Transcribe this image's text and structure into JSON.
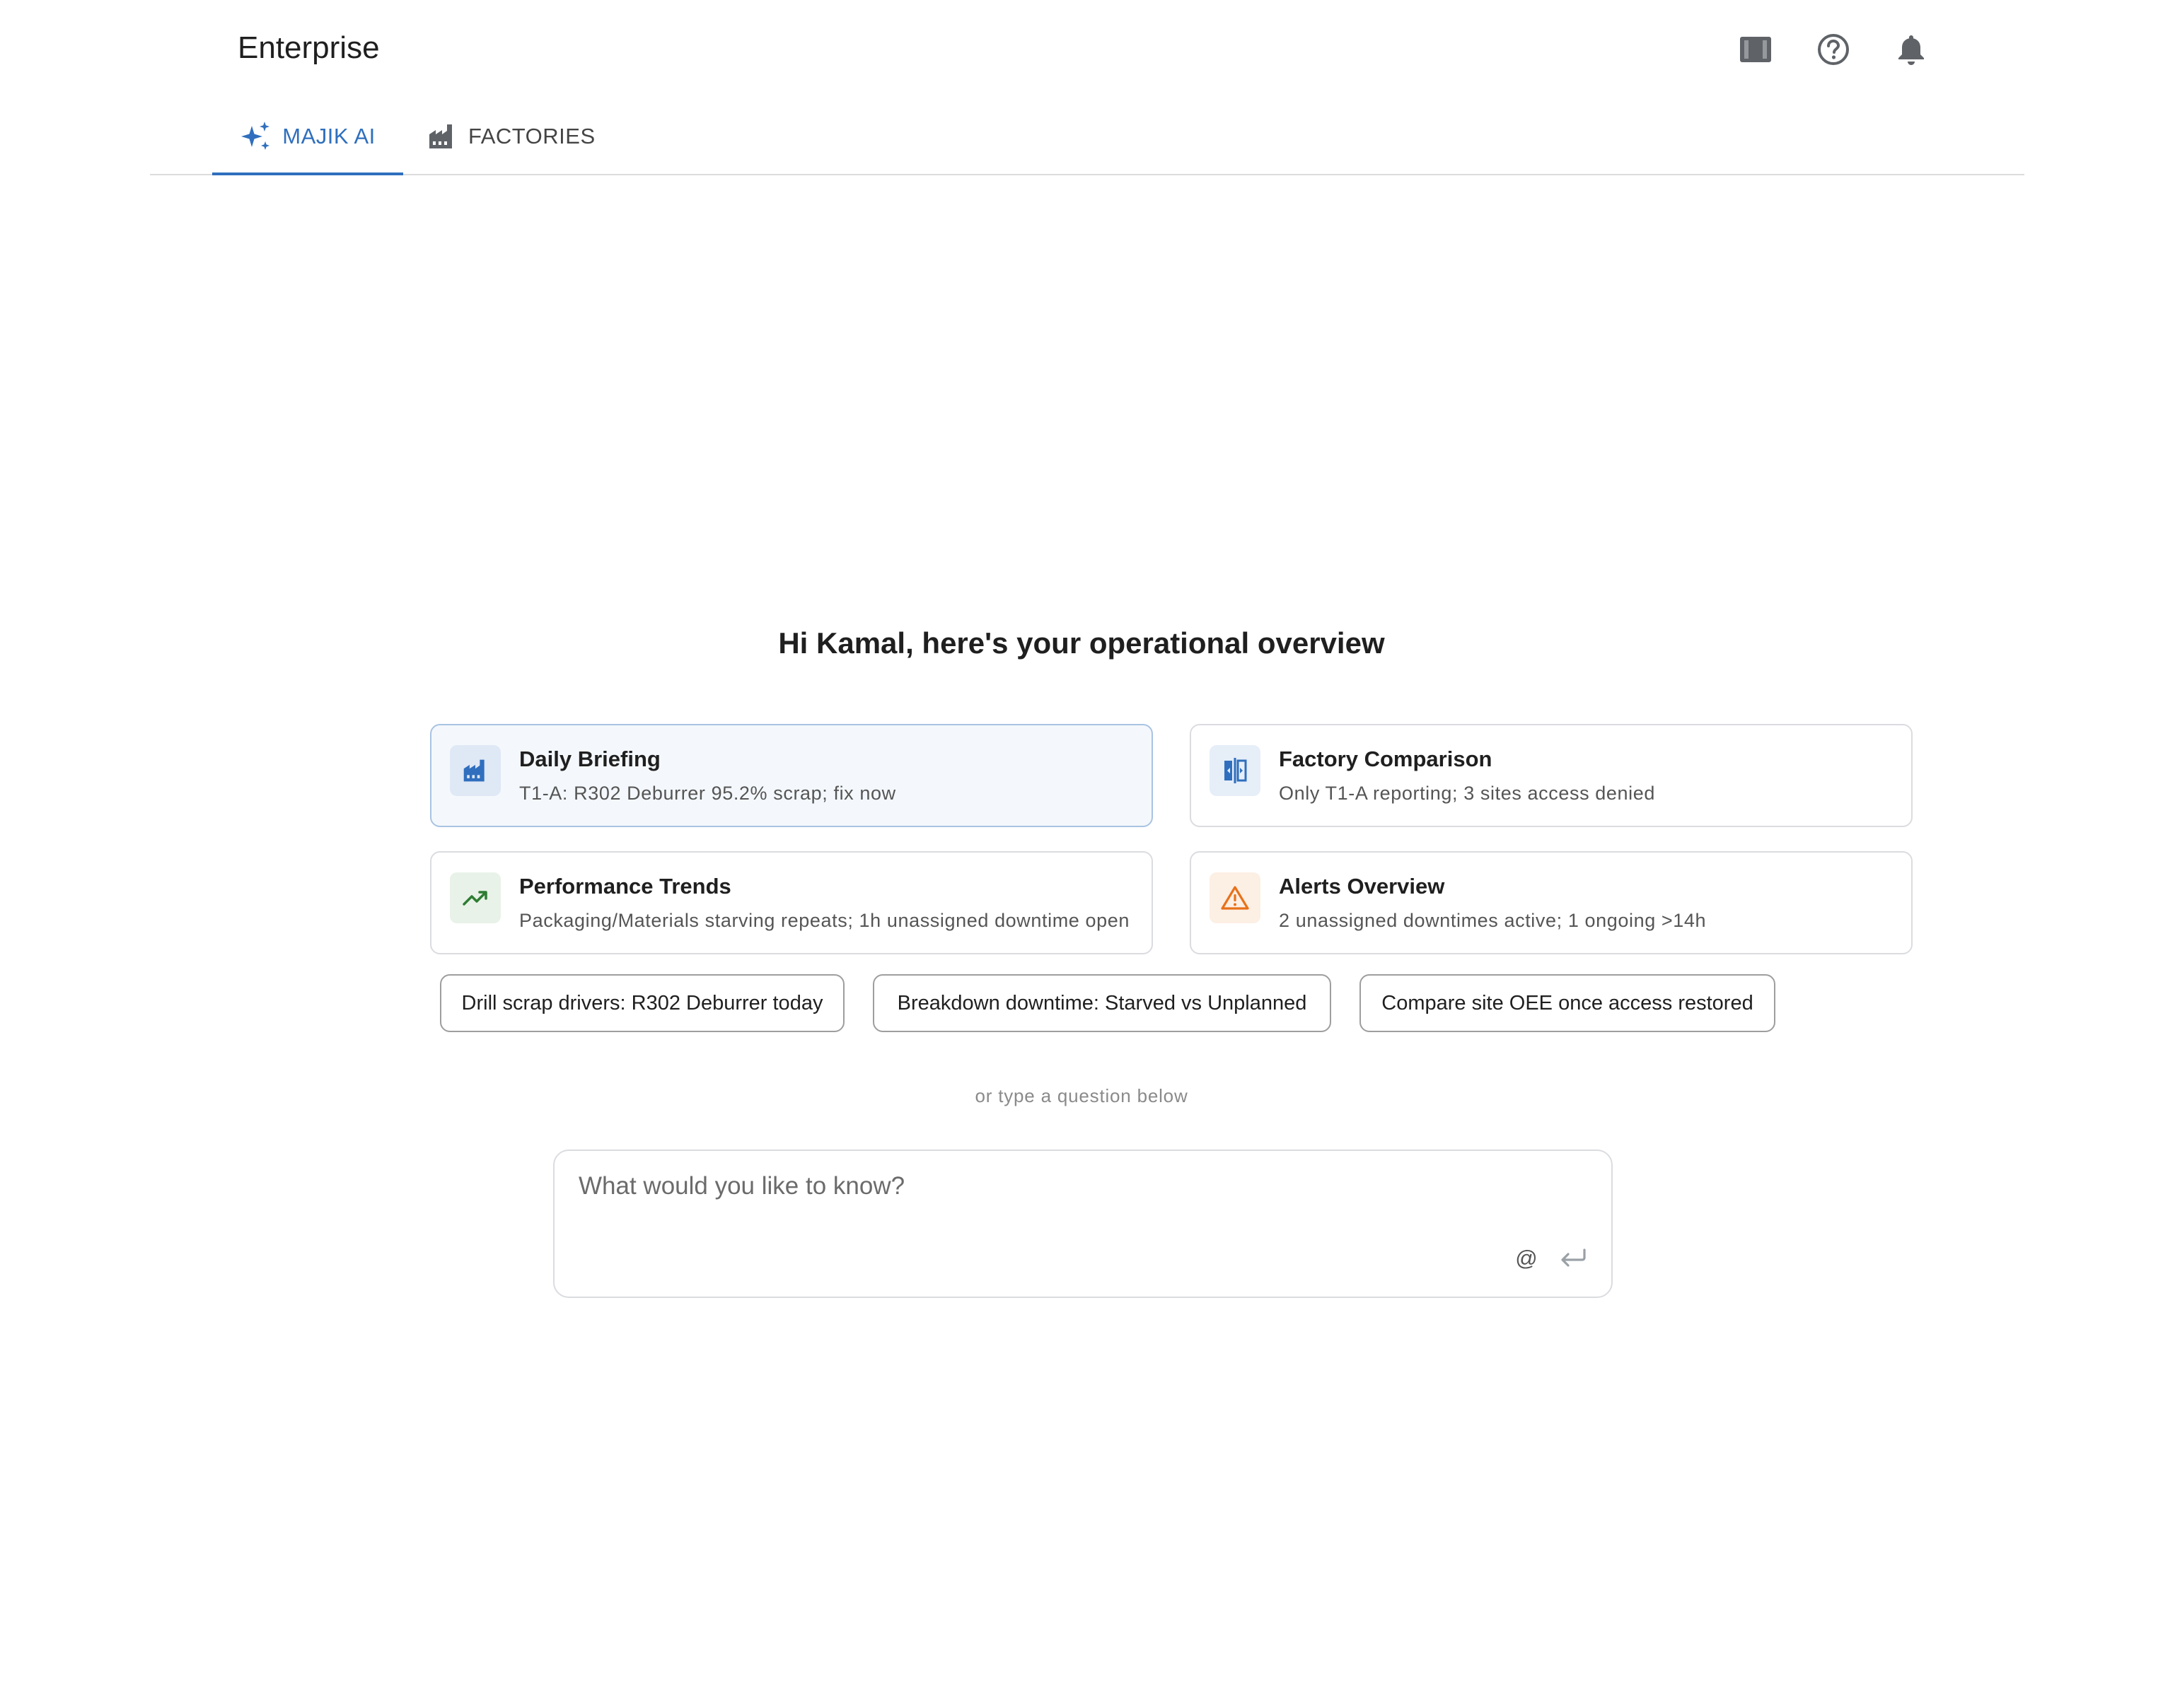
{
  "header": {
    "app_title": "Enterprise",
    "icons": [
      "view-panel-icon",
      "help-circle-icon",
      "bell-icon"
    ]
  },
  "tabs": [
    {
      "label": "MAJIK AI",
      "icon": "sparkle-icon",
      "active": true
    },
    {
      "label": "FACTORIES",
      "icon": "factory-icon",
      "active": false
    }
  ],
  "main": {
    "greeting": "Hi Kamal, here's your operational overview",
    "cards": [
      {
        "title": "Daily Briefing",
        "subtitle": "T1-A: R302 Deburrer 95.2% scrap; fix now",
        "icon": "factory-icon",
        "active": true
      },
      {
        "title": "Factory Comparison",
        "subtitle": "Only T1-A reporting; 3 sites access denied",
        "icon": "compare-icon",
        "active": false
      },
      {
        "title": "Performance Trends",
        "subtitle": "Packaging/Materials starving repeats; 1h unassigned downtime open",
        "icon": "trending-up-icon",
        "active": false
      },
      {
        "title": "Alerts Overview",
        "subtitle": "2 unassigned downtimes active; 1 ongoing >14h",
        "icon": "warning-icon",
        "active": false
      }
    ],
    "chips": [
      "Drill scrap drivers: R302 Deburrer today",
      "Breakdown downtime: Starved vs Unplanned",
      "Compare site OEE once access restored"
    ],
    "hint": "or type a question below",
    "prompt": {
      "placeholder": "What would you like to know?",
      "value": "",
      "mention_label": "@"
    }
  },
  "colors": {
    "accent": "#2f6fbe",
    "trend_green": "#2e7d32",
    "alert_orange": "#e8711a",
    "active_card_bg": "#f4f8fc"
  }
}
